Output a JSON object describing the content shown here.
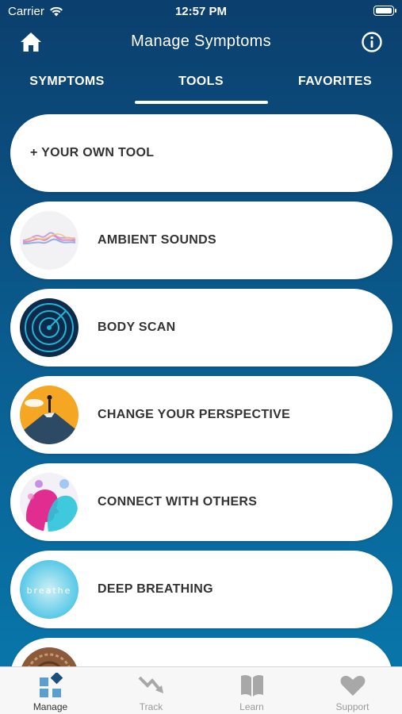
{
  "status_bar": {
    "carrier": "Carrier",
    "time": "12:57 PM"
  },
  "nav": {
    "title": "Manage Symptoms",
    "home_icon": "home-icon",
    "info_icon": "info-icon"
  },
  "tabs": [
    {
      "label": "SYMPTOMS",
      "selected": false
    },
    {
      "label": "TOOLS",
      "selected": true
    },
    {
      "label": "FAVORITES",
      "selected": false
    }
  ],
  "tools": {
    "add_label": "+ YOUR OWN TOOL",
    "items": [
      {
        "label": "AMBIENT SOUNDS",
        "icon": "ambient-sounds-thumbnail"
      },
      {
        "label": "BODY SCAN",
        "icon": "body-scan-thumbnail"
      },
      {
        "label": "CHANGE YOUR PERSPECTIVE",
        "icon": "change-perspective-thumbnail"
      },
      {
        "label": "CONNECT WITH OTHERS",
        "icon": "connect-others-thumbnail"
      },
      {
        "label": "DEEP BREATHING",
        "icon": "deep-breathing-thumbnail",
        "thumbnail_text": "breathe"
      },
      {
        "label": "",
        "icon": "partial-tool-thumbnail"
      }
    ]
  },
  "tabbar": [
    {
      "label": "Manage",
      "icon": "manage-icon",
      "active": true
    },
    {
      "label": "Track",
      "icon": "track-icon",
      "active": false
    },
    {
      "label": "Learn",
      "icon": "learn-icon",
      "active": false
    },
    {
      "label": "Support",
      "icon": "support-icon",
      "active": false
    }
  ],
  "colors": {
    "background_top": "#0b3f6d",
    "background_bottom": "#0879ad",
    "card": "#ffffff",
    "card_text": "#333333",
    "tabbar_active": "#2b6e96",
    "tabbar_inactive": "#9a9a9a"
  }
}
